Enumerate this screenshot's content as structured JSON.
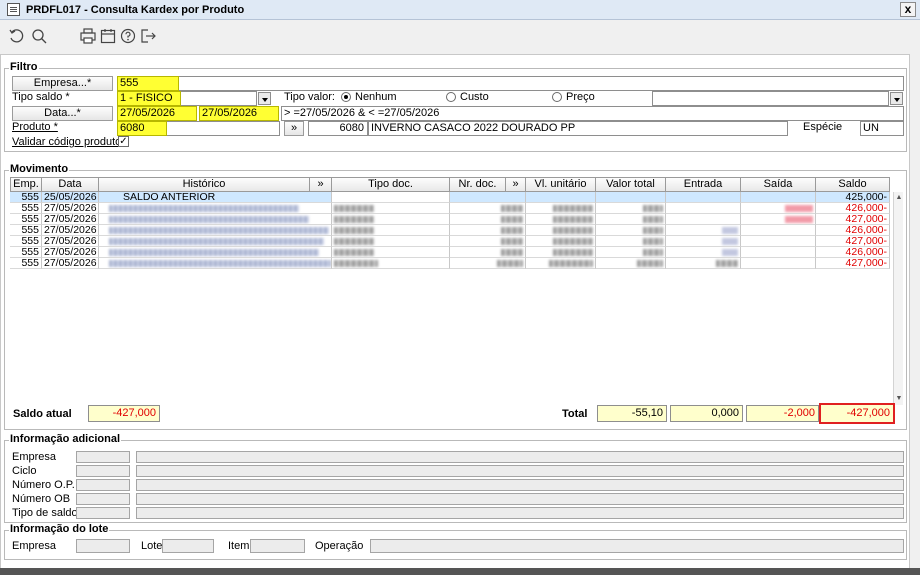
{
  "window": {
    "title": "PRDFL017 - Consulta Kardex por Produto",
    "close_label": "x"
  },
  "toolbar": {
    "icons": [
      "undo-icon",
      "search-icon",
      "print-icon",
      "calendar-icon",
      "help-icon",
      "exit-icon"
    ]
  },
  "filtro": {
    "label": "Filtro",
    "empresa_btn": "Empresa...*",
    "empresa_value": "555",
    "tipo_saldo_label": "Tipo saldo *",
    "tipo_saldo_value": "1 - FISICO",
    "tipo_valor_label": "Tipo valor:",
    "tipo_valor_options": [
      "Nenhum",
      "Custo",
      "Preço"
    ],
    "data_btn": "Data...*",
    "data_from": "27/05/2026",
    "data_to": "27/05/2026",
    "data_expr": "> =27/05/2026 & < =27/05/2026",
    "produto_label": "Produto *",
    "produto_value": "6080",
    "produto_btn": "»",
    "produto_code": "6080",
    "produto_desc": "INVERNO CASACO 2022 DOURADO PP",
    "especie_label": "Espécie",
    "especie_value": "UN",
    "validar_label": "Validar código produto",
    "validar_checked": "✓"
  },
  "movimento": {
    "label": "Movimento",
    "columns": [
      "Emp.",
      "Data",
      "Histórico",
      "»",
      "Tipo doc.",
      "Nr. doc.",
      "»",
      "Vl. unitário",
      "Valor total",
      "Entrada",
      "Saída",
      "Saldo"
    ],
    "rows": [
      {
        "emp": "555",
        "data": "25/05/2026",
        "historico": "SALDO ANTERIOR",
        "saldo": "425,000-"
      },
      {
        "emp": "555",
        "data": "27/05/2026",
        "saldo": "426,000-"
      },
      {
        "emp": "555",
        "data": "27/05/2026",
        "saldo": "427,000-"
      },
      {
        "emp": "555",
        "data": "27/05/2026",
        "saldo": "426,000-"
      },
      {
        "emp": "555",
        "data": "27/05/2026",
        "saldo": "427,000-"
      },
      {
        "emp": "555",
        "data": "27/05/2026",
        "saldo": "426,000-"
      },
      {
        "emp": "555",
        "data": "27/05/2026",
        "saldo": "427,000-"
      }
    ]
  },
  "summary": {
    "saldo_atual_label": "Saldo atual",
    "saldo_atual_value": "-427,000",
    "total_label": "Total",
    "valor_total": "-55,10",
    "entrada": "0,000",
    "saida": "-2,000",
    "saldo": "-427,000"
  },
  "info_adicional": {
    "label": "Informação adicional",
    "fields": [
      "Empresa",
      "Ciclo",
      "Número O.P.",
      "Número OB",
      "Tipo de saldo"
    ]
  },
  "info_lote": {
    "label": "Informação do lote",
    "empresa": "Empresa",
    "lote": "Lote",
    "item": "Item",
    "operacao": "Operação"
  }
}
